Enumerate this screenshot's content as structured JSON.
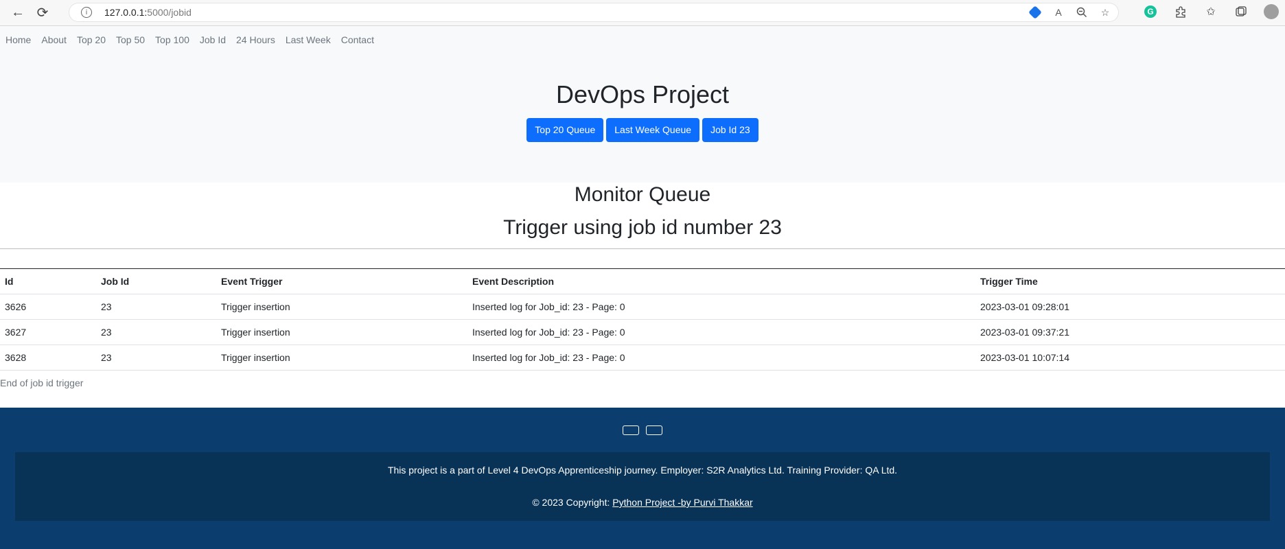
{
  "browser": {
    "url_host": "127.0.0.1:",
    "url_path": "5000/jobid",
    "back_glyph": "←",
    "reload_glyph": "⟳"
  },
  "nav": {
    "items": [
      "Home",
      "About",
      "Top 20",
      "Top 50",
      "Top 100",
      "Job Id",
      "24 Hours",
      "Last Week",
      "Contact"
    ]
  },
  "hero": {
    "title": "DevOps Project",
    "buttons": [
      "Top 20 Queue",
      "Last Week Queue",
      "Job Id 23"
    ]
  },
  "main": {
    "title": "Monitor Queue",
    "subtitle": "Trigger using job id number 23"
  },
  "table": {
    "headers": [
      "Id",
      "Job Id",
      "Event Trigger",
      "Event Description",
      "Trigger Time"
    ],
    "rows": [
      [
        "3626",
        "23",
        "Trigger insertion",
        "Inserted log for Job_id: 23 - Page: 0",
        "2023-03-01 09:28:01"
      ],
      [
        "3627",
        "23",
        "Trigger insertion",
        "Inserted log for Job_id: 23 - Page: 0",
        "2023-03-01 09:37:21"
      ],
      [
        "3628",
        "23",
        "Trigger insertion",
        "Inserted log for Job_id: 23 - Page: 0",
        "2023-03-01 10:07:14"
      ]
    ],
    "footer_text": "End of job id trigger"
  },
  "footer": {
    "line1": "This project is a part of Level 4 DevOps Apprenticeship journey. Employer: S2R Analytics Ltd. Training Provider: QA Ltd.",
    "copyright_prefix": "© 2023 Copyright: ",
    "copyright_link": "Python Project -by Purvi Thakkar"
  }
}
